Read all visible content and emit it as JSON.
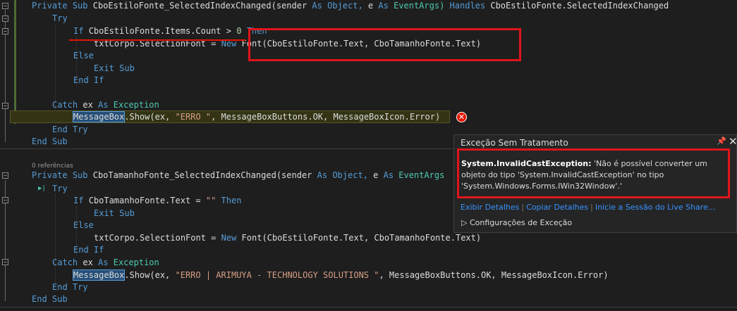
{
  "code": {
    "l1": {
      "private": "Private",
      "sub": "Sub",
      "name": "CboEstiloFonte_SelectedIndexChanged(sender",
      "as1": "As",
      "object": "Object,",
      "e": "e",
      "as2": "As",
      "eventargs": "EventArgs)",
      "handles": "Handles",
      "handlesTarget": "CboEstiloFonte.SelectedIndexChanged"
    },
    "l2": {
      "try": "Try"
    },
    "l3": {
      "if": "If",
      "cond": "CboEstiloFonte.Items.Count > ",
      "zero": "0",
      "then": "Then"
    },
    "l4": {
      "lhs": "txtCorpo.SelectionFont = ",
      "new": "New",
      "font": "Font(CboEstiloFonte.Text, CboTamanhoFonte.Text)"
    },
    "l5": {
      "else": "Else"
    },
    "l6": {
      "exitSub": "Exit Sub"
    },
    "l7": {
      "endIf": "End If"
    },
    "l8": {
      "catch": "Catch",
      "ex": "ex",
      "as": "As",
      "exception": "Exception"
    },
    "l9": {
      "msgbox": "MessageBox",
      "show": ".Show(ex, ",
      "str": "\"ERRO \"",
      "rest": ", MessageBoxButtons.OK, MessageBoxIcon.Error)"
    },
    "l10": {
      "endTry": "End Try"
    },
    "l11": {
      "endSub": "End Sub"
    },
    "refs": "0 referências",
    "m1": {
      "private": "Private",
      "sub": "Sub",
      "name": "CboTamanhoFonte_SelectedIndexChanged(sender",
      "as1": "As",
      "object": "Object,",
      "e": "e",
      "as2": "As",
      "eventargs": "EventArgs"
    },
    "m2": {
      "try": "Try"
    },
    "m3": {
      "if": "If",
      "cond": "CboTamanhoFonte.Text = ",
      "str": "\"\"",
      "then": "Then"
    },
    "m4": {
      "exitSub": "Exit Sub"
    },
    "m5": {
      "else": "Else"
    },
    "m6": {
      "lhs": "txtCorpo.SelectionFont = ",
      "new": "New",
      "font": "Font(CboEstiloFonte.Text, CboTamanhoFonte.Text)"
    },
    "m7": {
      "endIf": "End If"
    },
    "m8": {
      "catch": "Catch",
      "ex": "ex",
      "as": "As",
      "exception": "Exception"
    },
    "m9": {
      "msgbox": "MessageBox",
      "show": ".Show(ex, ",
      "str": "\"ERRO | ARIMUYA - TECHNOLOGY SOLUTIONS \"",
      "rest": ", MessageBoxButtons.OK, MessageBoxIcon.Error)"
    },
    "m10": {
      "endTry": "End Try"
    },
    "m11": {
      "endSub": "End Sub"
    }
  },
  "exception": {
    "title": "Exceção Sem Tratamento",
    "type": "System.InvalidCastException:",
    "message": " 'Não é possível converter um objeto do tipo 'System.InvalidCastException' no tipo 'System.Windows.Forms.IWin32Window'.'",
    "links": [
      "Exibir Detalhes",
      "Copiar Detalhes",
      "Inicie a Sessão do Live Share..."
    ],
    "config": "Configurações de Exceção"
  },
  "colors": {
    "keyword": "#569cd6",
    "type": "#4ec9b0",
    "string": "#d69d85",
    "error": "#e51400",
    "link": "#3794ff"
  }
}
